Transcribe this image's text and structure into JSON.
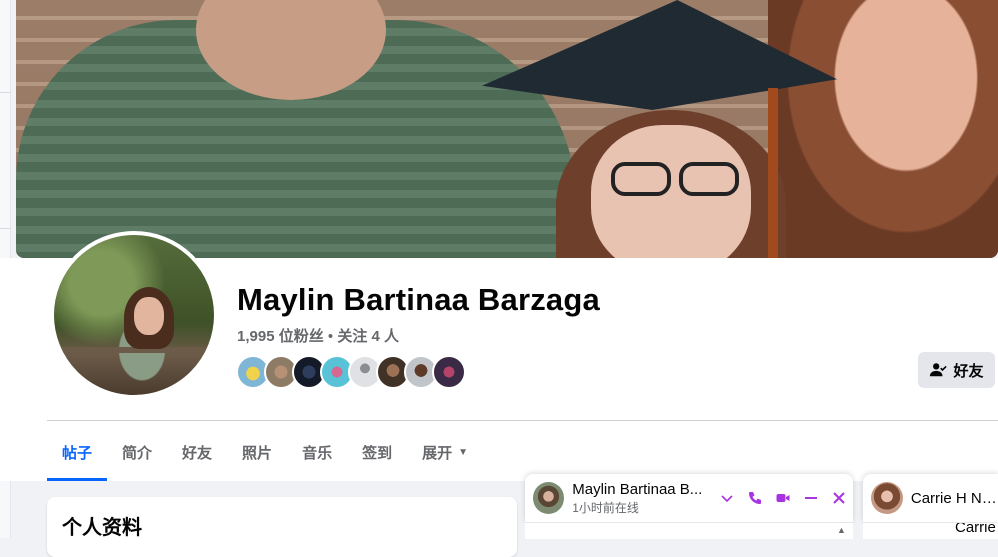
{
  "profile": {
    "name": "Maylin Bartinaa Barzaga",
    "followers": "1,995 位粉丝",
    "separator": " • ",
    "following": "关注 4 人",
    "friend_button_label": "好友"
  },
  "tabs": [
    {
      "label": "帖子",
      "active": true
    },
    {
      "label": "简介",
      "active": false
    },
    {
      "label": "好友",
      "active": false
    },
    {
      "label": "照片",
      "active": false
    },
    {
      "label": "音乐",
      "active": false
    },
    {
      "label": "签到",
      "active": false
    },
    {
      "label": "展开",
      "active": false
    }
  ],
  "intro": {
    "title": "个人资料"
  },
  "chat": {
    "name": "Maylin Bartinaa B...",
    "status": "1小时前在线",
    "accent": "#a933e0"
  },
  "chat2": {
    "name": "Carrie H Ngu",
    "preview": "Carrie"
  },
  "colors": {
    "brand_blue": "#0866ff",
    "secondary_text": "#65676b"
  },
  "friend_avatars": [
    "friend-1",
    "friend-2",
    "friend-3",
    "friend-4",
    "friend-5",
    "friend-6",
    "friend-7",
    "friend-8"
  ]
}
